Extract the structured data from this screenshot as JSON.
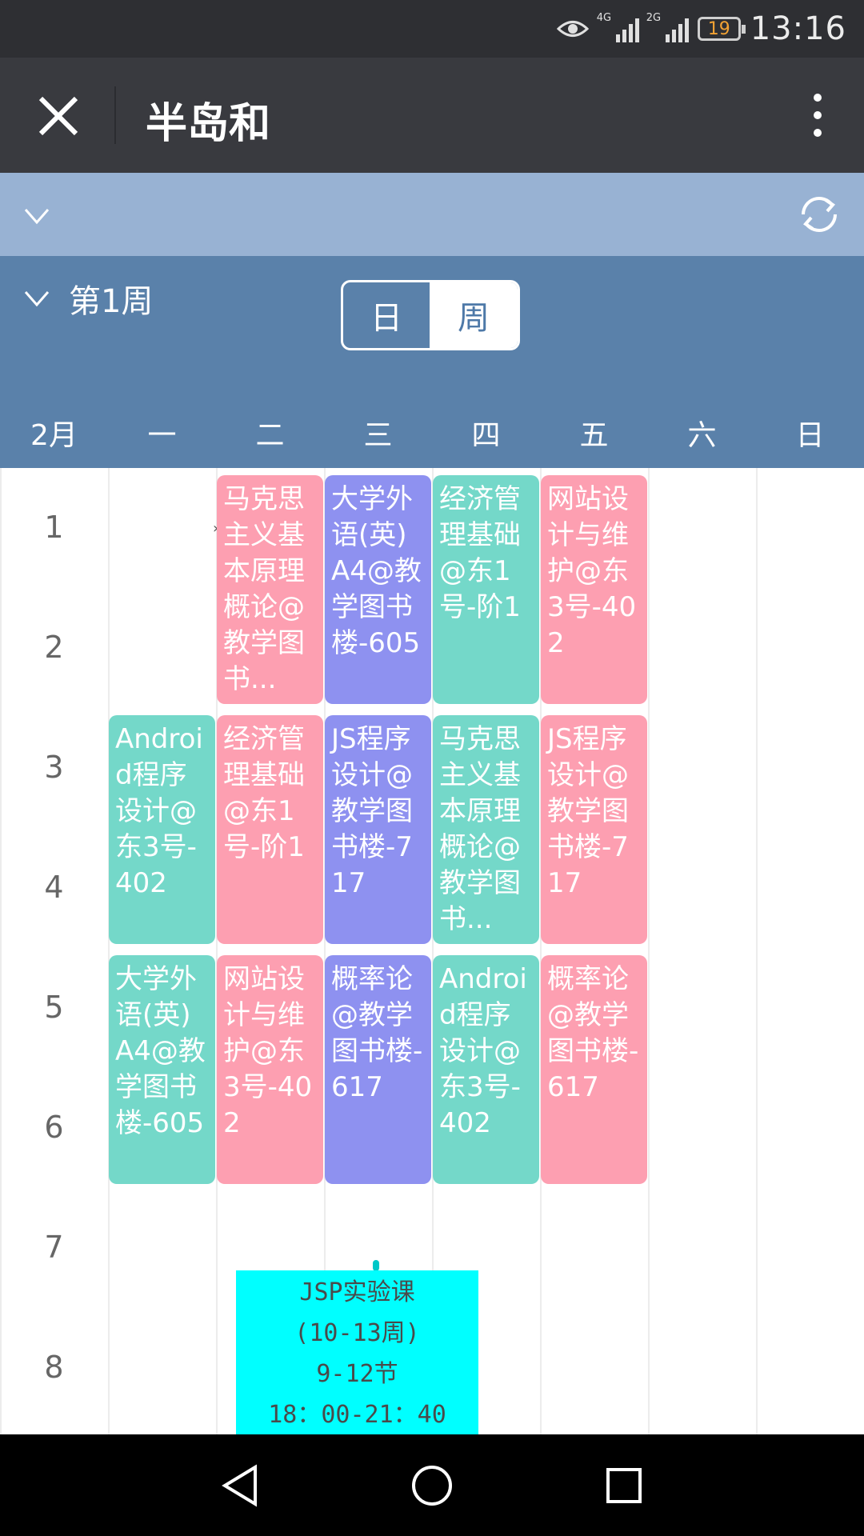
{
  "status_bar": {
    "time": "13:16",
    "battery": "19",
    "net1": "4G",
    "net2": "2G",
    "icons": [
      "eye-icon",
      "signal-4g-icon",
      "signal-2g-icon",
      "battery-icon"
    ]
  },
  "app_bar": {
    "title": "半岛和",
    "close_icon": "close-icon",
    "more_icon": "more-vertical-icon"
  },
  "top_strip": {
    "collapse_icon": "chevron-down-icon",
    "refresh_icon": "refresh-icon"
  },
  "week_header": {
    "week_label": "第1周",
    "toggle_day": "日",
    "toggle_week": "周",
    "selected": "周",
    "month": "2月",
    "days": [
      "一",
      "二",
      "三",
      "四",
      "五",
      "六",
      "日"
    ]
  },
  "periods": [
    "1",
    "2",
    "3",
    "4",
    "5",
    "6",
    "7",
    "8"
  ],
  "courses": [
    {
      "id": "c1",
      "text": "马克思主义基本原理概论@教学图书...",
      "color": "#fd9fb1"
    },
    {
      "id": "c2",
      "text": "大学外语(英)A4@教学图书楼-605",
      "color": "#8e91f0"
    },
    {
      "id": "c3",
      "text": "经济管理基础@东1号-阶1",
      "color": "#74d8c9"
    },
    {
      "id": "c4",
      "text": "网站设计与维护@东3号-402",
      "color": "#fd9fb1"
    },
    {
      "id": "c5",
      "text": "Android程序设计@东3号-402",
      "color": "#74d8c9"
    },
    {
      "id": "c6",
      "text": "经济管理基础@东1号-阶1",
      "color": "#fd9fb1"
    },
    {
      "id": "c7",
      "text": "JS程序设计@教学图书楼-717",
      "color": "#8e91f0"
    },
    {
      "id": "c8",
      "text": "马克思主义基本原理概论@教学图书...",
      "color": "#74d8c9"
    },
    {
      "id": "c9",
      "text": "JS程序设计@教学图书楼-717",
      "color": "#fd9fb1"
    },
    {
      "id": "c10",
      "text": "大学外语(英)A4@教学图书楼-605",
      "color": "#74d8c9"
    },
    {
      "id": "c11",
      "text": "网站设计与维护@东3号-402",
      "color": "#fd9fb1"
    },
    {
      "id": "c12",
      "text": "概率论@教学图书楼-617",
      "color": "#8e91f0"
    },
    {
      "id": "c13",
      "text": "Android程序设计@东3号-402",
      "color": "#74d8c9"
    },
    {
      "id": "c14",
      "text": "概率论@教学图书楼-617",
      "color": "#fd9fb1"
    }
  ],
  "lab_note": {
    "line1": "JSP实验课",
    "line2": "(10-13周)",
    "line3": "9-12节",
    "line4": "18：00-21：40",
    "color": "#00ffff"
  },
  "nav_bar": {
    "back_icon": "back-triangle-icon",
    "home_icon": "home-circle-icon",
    "recents_icon": "recents-square-icon"
  }
}
